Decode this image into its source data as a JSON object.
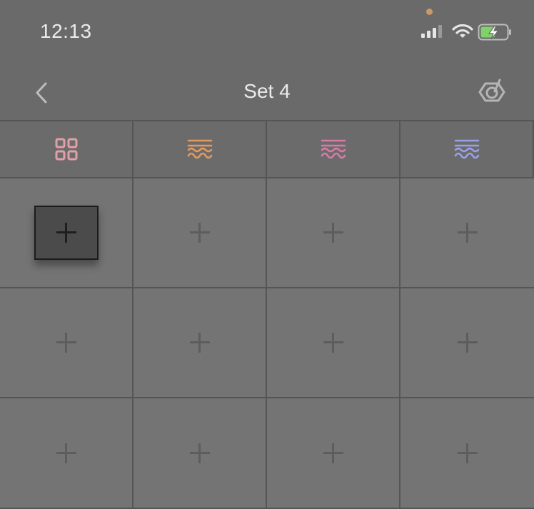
{
  "status_bar": {
    "time": "12:13",
    "icons": [
      "signal-icon",
      "wifi-icon",
      "battery-charging-icon"
    ],
    "colors": {
      "battery": "#7fd16a",
      "privacy_dot": "#c89a6a"
    }
  },
  "nav": {
    "title": "Set 4",
    "left_icon": "back-chevron-icon",
    "right_icon": "app-logo-icon"
  },
  "tabs": [
    {
      "icon": "grid-icon",
      "color": "#e0a0a8"
    },
    {
      "icon": "wave-orange-icon",
      "color": "#e39a5e"
    },
    {
      "icon": "wave-pink-icon",
      "color": "#d77aa8"
    },
    {
      "icon": "wave-blue-icon",
      "color": "#9aa0e6"
    }
  ],
  "pads": {
    "rows": 3,
    "cols": 4,
    "selected": [
      0,
      0
    ],
    "icon": "plus-icon"
  }
}
